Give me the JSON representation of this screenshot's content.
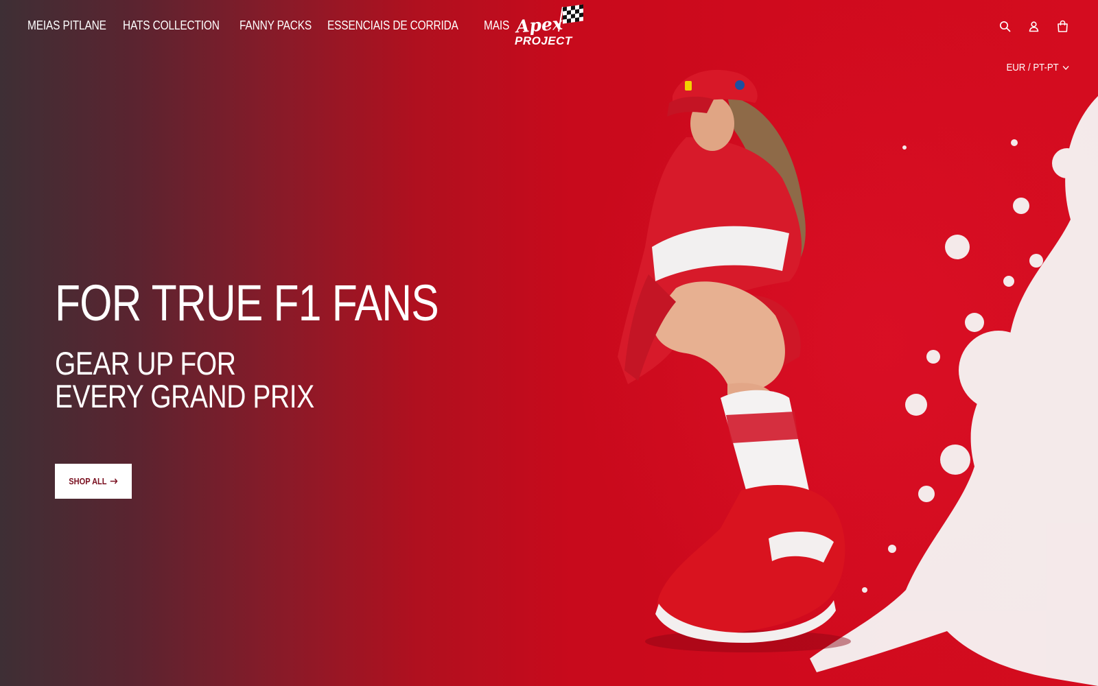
{
  "header": {
    "nav": [
      {
        "label": "MEIAS PITLANE"
      },
      {
        "label": "HATS COLLECTION"
      },
      {
        "label": "FANNY PACKS"
      },
      {
        "label": "ESSENCIAIS DE CORRIDA"
      },
      {
        "label": "MAIS"
      }
    ],
    "logo": {
      "line1": "Apex",
      "line2": "PROJECT"
    },
    "icons": [
      "search-icon",
      "account-icon",
      "cart-icon"
    ],
    "locale": "EUR / PT-PT"
  },
  "hero": {
    "title": "FOR TRUE F1 FANS",
    "subtitle_line1": "GEAR UP FOR",
    "subtitle_line2": "EVERY GRAND PRIX",
    "cta_label": "SHOP ALL",
    "cta_icon": "arrow-right-icon"
  },
  "colors": {
    "brand_red": "#c80a1c",
    "dark_left": "#3e2f35",
    "white": "#ffffff",
    "cta_text": "#7a1020"
  }
}
